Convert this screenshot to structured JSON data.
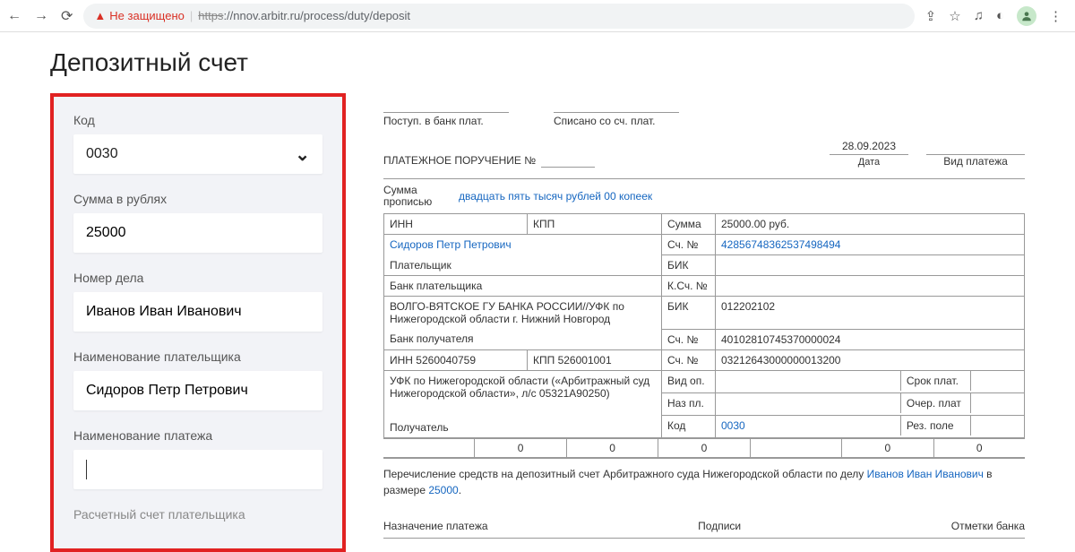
{
  "browser": {
    "security_label": "Не защищено",
    "url_scheme": "https",
    "url_rest": "://nnov.arbitr.ru/process/duty/deposit"
  },
  "page_title": "Депозитный счет",
  "form": {
    "code_label": "Код",
    "code_value": "0030",
    "amount_label": "Сумма в рублях",
    "amount_value": "25000",
    "case_label": "Номер дела",
    "case_value": "Иванов Иван Иванович",
    "payer_label": "Наименование плательщика",
    "payer_value": "Сидоров Петр Петрович",
    "payment_name_label": "Наименование платежа",
    "payment_name_value": "",
    "next_label": "Расчетный счет плательщика"
  },
  "doc": {
    "bank_in": "Поступ. в банк плат.",
    "bank_out": "Списано со сч. плат.",
    "order_title": "ПЛАТЕЖНОЕ ПОРУЧЕНИЕ №",
    "date": "28.09.2023",
    "date_lbl": "Дата",
    "kind_lbl": "Вид платежа",
    "sum_words_lbl": "Сумма прописью",
    "sum_words_val": "двадцать пять тысяч рублей 00 копеек",
    "inn": "ИНН",
    "kpp": "КПП",
    "sum_lbl": "Сумма",
    "sum_val": "25000.00 руб.",
    "payer_name": "Сидоров Петр Петрович",
    "acct_lbl": "Сч. №",
    "payer_acct": "42856748362537498494",
    "payer_lbl": "Плательщик",
    "bik_lbl": "БИК",
    "payer_bank_lbl": "Банк плательщика",
    "kacct_lbl": "К.Сч. №",
    "recv_bank": "ВОЛГО-ВЯТСКОЕ ГУ БАНКА РОССИИ//УФК по Нижегородской области г. Нижний Новгород",
    "recv_bik": "012202102",
    "recv_bank_lbl": "Банк получателя",
    "recv_bank_acct": "40102810745370000024",
    "recv_inn": "ИНН 5260040759",
    "recv_kpp": "КПП 526001001",
    "recv_acct2": "03212643000000013200",
    "recv_name": "УФК по Нижегородской области («Арбитражный суд Нижегородской области», л/с 05321А90250)",
    "vid_op": "Вид оп.",
    "srok": "Срок плат.",
    "naz_pl": "Наз пл.",
    "ocher": "Очер. плат",
    "recv_lbl": "Получатель",
    "code_lbl": "Код",
    "code_val": "0030",
    "rez": "Рез. поле",
    "zeros": [
      "",
      "0",
      "0",
      "0",
      "",
      "0",
      "0"
    ],
    "purpose_1": "Перечисление средств на депозитный счет Арбитражного суда Нижегородской области по делу ",
    "purpose_link1": "Иванов Иван Иванович",
    "purpose_2": " в размере ",
    "purpose_link2": "25000",
    "purpose_3": ".",
    "foot1": "Назначение платежа",
    "foot2": "Подписи",
    "foot3": "Отметки банка"
  }
}
